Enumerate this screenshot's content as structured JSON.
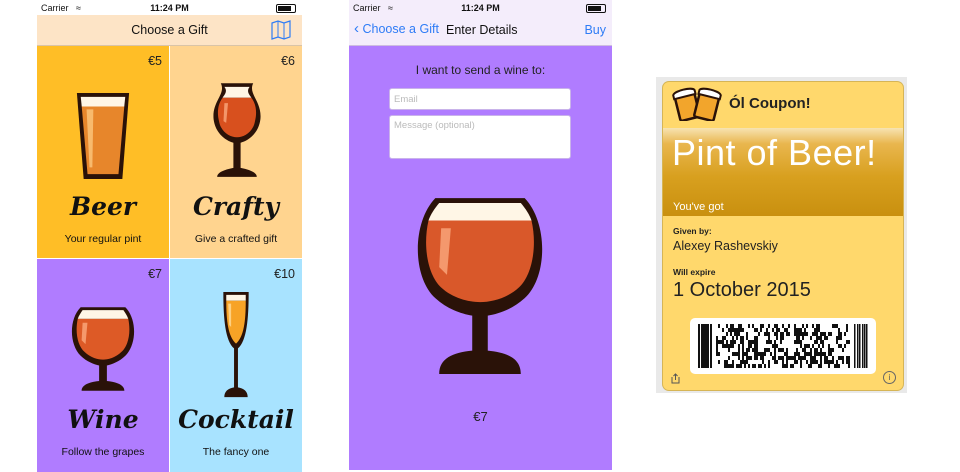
{
  "status_bar": {
    "carrier": "Carrier",
    "time": "11:24 PM"
  },
  "gift_list_screen": {
    "title": "Choose a Gift",
    "map_icon": "map-icon",
    "gifts": [
      {
        "name": "Beer",
        "description": "Your regular pint",
        "price": "€5",
        "color": "#ffbe26",
        "icon": "pint-glass-icon"
      },
      {
        "name": "Crafty",
        "description": "Give a crafted gift",
        "price": "€6",
        "color": "#ffd48f",
        "icon": "tulip-glass-icon"
      },
      {
        "name": "Wine",
        "description": "Follow the grapes",
        "price": "€7",
        "color": "#b07cff",
        "icon": "snifter-glass-icon"
      },
      {
        "name": "Cocktail",
        "description": "The fancy one",
        "price": "€10",
        "color": "#a8e3ff",
        "icon": "champagne-flute-icon"
      }
    ]
  },
  "details_screen": {
    "back_label": "Choose a Gift",
    "title": "Enter Details",
    "buy_label": "Buy",
    "intro": "I want to send a wine to:",
    "email_placeholder": "Email",
    "message_placeholder": "Message (optional)",
    "price": "€7",
    "background": "#b07cff"
  },
  "pass": {
    "logo_text": "Ól Coupon!",
    "logo_icon": "clinking-beers-icon",
    "strip_value": "Pint of Beer!",
    "strip_label": "You've got",
    "given_by_label": "Given by:",
    "given_by_value": "Alexey Rashevskiy",
    "expire_label": "Will expire",
    "expire_value": "1 October 2015",
    "barcode_icon": "pdf417-barcode",
    "share_icon": "share-icon",
    "info_icon": "info-icon",
    "background": "#ffd86c"
  }
}
